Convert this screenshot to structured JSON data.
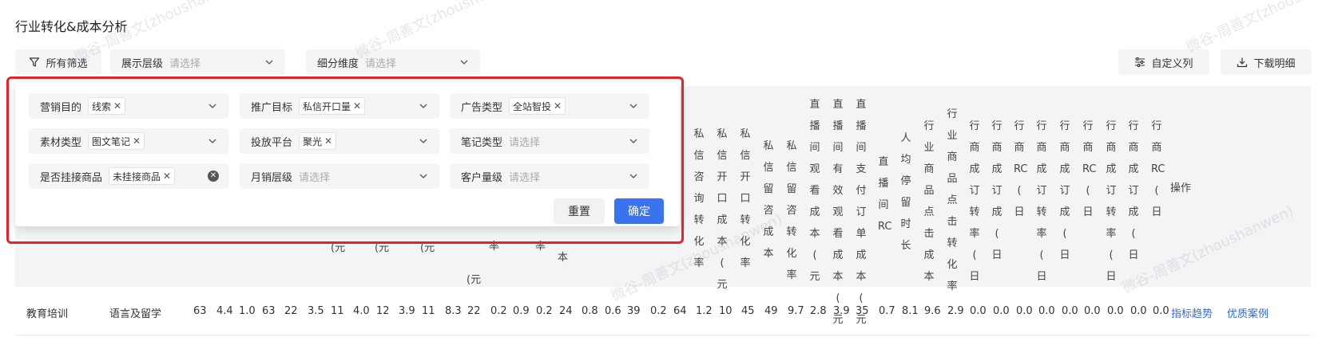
{
  "page": {
    "title": "行业转化&成本分析"
  },
  "toolbar": {
    "all_filters": "所有筛选",
    "display_level": {
      "label": "展示层级",
      "placeholder": "请选择"
    },
    "sub_dimension": {
      "label": "细分维度",
      "placeholder": "请选择"
    },
    "custom_columns": "自定义列",
    "download_detail": "下载明细"
  },
  "filter_popup": {
    "fields": [
      {
        "label": "营销目的",
        "tag": "线索",
        "placeholder": ""
      },
      {
        "label": "推广目标",
        "tag": "私信开口量",
        "placeholder": ""
      },
      {
        "label": "广告类型",
        "tag": "全站智投",
        "placeholder": ""
      },
      {
        "label": "素材类型",
        "tag": "图文笔记",
        "placeholder": ""
      },
      {
        "label": "投放平台",
        "tag": "聚光",
        "placeholder": ""
      },
      {
        "label": "笔记类型",
        "tag": "",
        "placeholder": "请选择"
      },
      {
        "label": "是否挂接商品",
        "tag": "未挂接商品",
        "placeholder": ""
      },
      {
        "label": "月销层级",
        "tag": "",
        "placeholder": "请选择"
      },
      {
        "label": "客户量级",
        "tag": "",
        "placeholder": "请选择"
      }
    ],
    "reset": "重置",
    "confirm": "确定"
  },
  "table": {
    "vertical_headers": [
      "私信咨询转化率",
      "私信开口成本(元",
      "私信开口转化率",
      "私信留咨成本",
      "私信留咨转化率",
      "直播间观看成本(元",
      "直播间有效观看成本(元",
      "直播间支付订单成本(元",
      "直播间RC",
      "人均停留时长",
      "行业商品点击成本",
      "行业商品点击转化率",
      "行商成订转率(日",
      "行商成订成(日",
      "行商RC(日",
      "行商成订转率(日",
      "行商成订成(日",
      "行商RC(日",
      "行商成订转率(日",
      "行商成订成(日",
      "行商RC(日"
    ],
    "partial_headers": [
      "(元",
      "(元",
      "(元",
      "率",
      "率",
      "本",
      "(元"
    ],
    "operation_header": "操作",
    "row": {
      "industry": "教育培训",
      "category": "语言及留学",
      "values": [
        "63",
        "4.4",
        "1.0",
        "63",
        "22",
        "3.5",
        "11",
        "4.0",
        "12",
        "3.9",
        "11",
        "8.3",
        "22",
        "0.2",
        "0.9",
        "0.2",
        "24",
        "0.8",
        "0.6",
        "39",
        "0.2",
        "64",
        "1.2",
        "10",
        "45",
        "49",
        "9.7",
        "2.8",
        "3.9",
        "35",
        "0.7",
        "8.1",
        "9.6",
        "2.9",
        "0.0",
        "0.0",
        "0.0",
        "0.0",
        "0.0",
        "0.0",
        "0.0",
        "0.0",
        "0.0"
      ],
      "link_trend": "指标趋势",
      "link_cases": "优质案例"
    }
  },
  "watermark": "微谷-周善文(zhoushanwen)",
  "colors": {
    "primary": "#3a73f0",
    "highlight": "#e5232a",
    "link": "#2f6bdf"
  }
}
